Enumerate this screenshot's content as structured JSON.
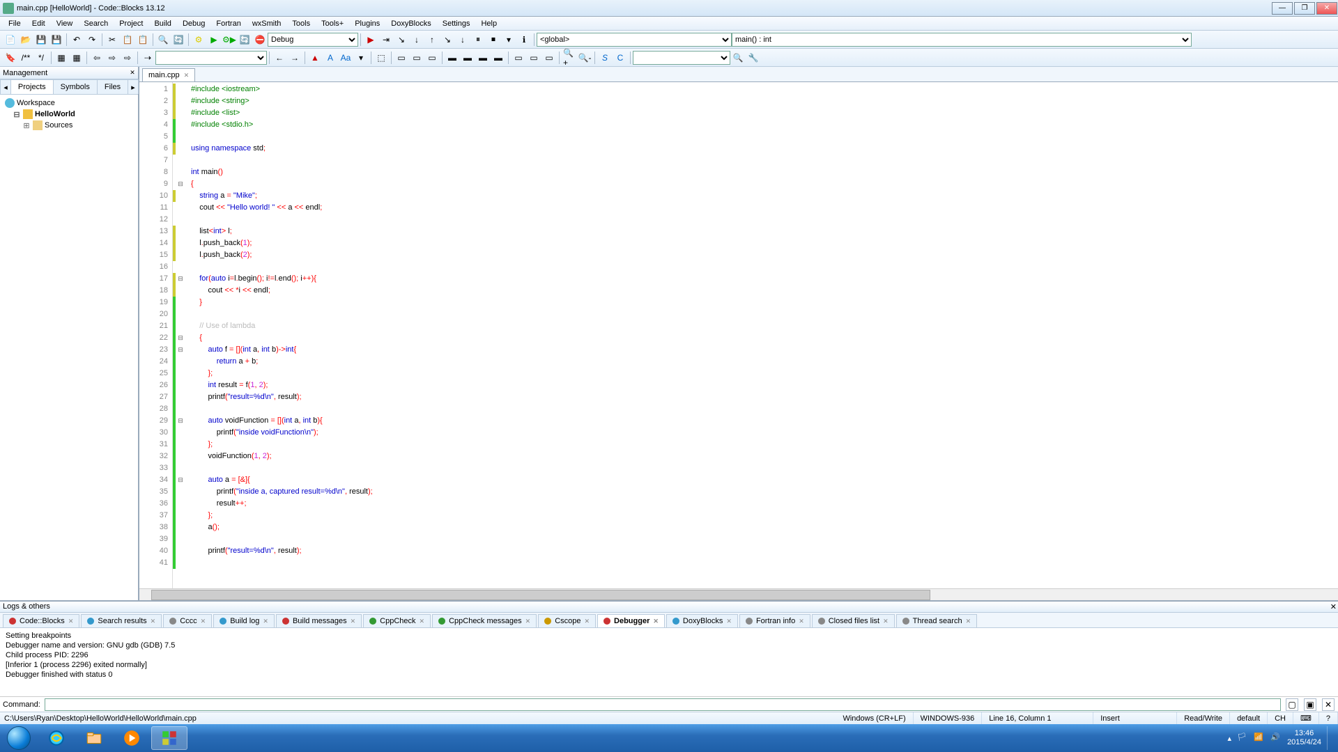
{
  "window": {
    "title": "main.cpp [HelloWorld] - Code::Blocks 13.12"
  },
  "menu": [
    "File",
    "Edit",
    "View",
    "Search",
    "Project",
    "Build",
    "Debug",
    "Fortran",
    "wxSmith",
    "Tools",
    "Tools+",
    "Plugins",
    "DoxyBlocks",
    "Settings",
    "Help"
  ],
  "toolbar1": {
    "build_target": "Debug",
    "scope": "<global>",
    "func": "main() : int"
  },
  "mgmt": {
    "title": "Management",
    "tabs": [
      "Projects",
      "Symbols",
      "Files"
    ],
    "workspace": "Workspace",
    "project": "HelloWorld",
    "folder": "Sources"
  },
  "editor": {
    "tab": "main.cpp",
    "lines": [
      {
        "n": 1,
        "change": "y",
        "tokens": [
          {
            "t": "#include ",
            "c": "pp"
          },
          {
            "t": "<iostream>",
            "c": "pp"
          }
        ]
      },
      {
        "n": 2,
        "change": "y",
        "tokens": [
          {
            "t": "#include ",
            "c": "pp"
          },
          {
            "t": "<string>",
            "c": "pp"
          }
        ]
      },
      {
        "n": 3,
        "change": "y",
        "tokens": [
          {
            "t": "#include ",
            "c": "pp"
          },
          {
            "t": "<list>",
            "c": "pp"
          }
        ]
      },
      {
        "n": 4,
        "change": "g",
        "tokens": [
          {
            "t": "#include ",
            "c": "pp"
          },
          {
            "t": "<stdio.h>",
            "c": "pp"
          }
        ]
      },
      {
        "n": 5,
        "change": "g",
        "tokens": [
          {
            "t": " "
          }
        ]
      },
      {
        "n": 6,
        "change": "y",
        "tokens": [
          {
            "t": "using namespace ",
            "c": "kw"
          },
          {
            "t": "std",
            "c": ""
          },
          {
            "t": ";",
            "c": "op"
          }
        ]
      },
      {
        "n": 7,
        "tokens": [
          {
            "t": " "
          }
        ]
      },
      {
        "n": 8,
        "tokens": [
          {
            "t": "int ",
            "c": "kw"
          },
          {
            "t": "main",
            "c": ""
          },
          {
            "t": "()",
            "c": "op"
          }
        ]
      },
      {
        "n": 9,
        "fold": "[-]",
        "tokens": [
          {
            "t": "{",
            "c": "op"
          }
        ]
      },
      {
        "n": 10,
        "change": "y",
        "tokens": [
          {
            "t": "    "
          },
          {
            "t": "string ",
            "c": "kw"
          },
          {
            "t": "a ",
            "c": ""
          },
          {
            "t": "= ",
            "c": "op"
          },
          {
            "t": "\"Mike\"",
            "c": "str"
          },
          {
            "t": ";",
            "c": "op"
          }
        ]
      },
      {
        "n": 11,
        "tokens": [
          {
            "t": "    "
          },
          {
            "t": "cout ",
            "c": ""
          },
          {
            "t": "<< ",
            "c": "op"
          },
          {
            "t": "\"Hello world! \"",
            "c": "str"
          },
          {
            "t": " << ",
            "c": "op"
          },
          {
            "t": "a",
            "c": ""
          },
          {
            "t": " << ",
            "c": "op"
          },
          {
            "t": "endl",
            "c": ""
          },
          {
            "t": ";",
            "c": "op"
          }
        ]
      },
      {
        "n": 12,
        "tokens": [
          {
            "t": " "
          }
        ]
      },
      {
        "n": 13,
        "change": "y",
        "tokens": [
          {
            "t": "    "
          },
          {
            "t": "list",
            "c": ""
          },
          {
            "t": "<",
            "c": "op"
          },
          {
            "t": "int",
            "c": "kw"
          },
          {
            "t": "> ",
            "c": "op"
          },
          {
            "t": "l",
            "c": ""
          },
          {
            "t": ";",
            "c": "op"
          }
        ]
      },
      {
        "n": 14,
        "change": "y",
        "tokens": [
          {
            "t": "    l"
          },
          {
            "t": ".",
            "c": "op"
          },
          {
            "t": "push_back",
            "c": ""
          },
          {
            "t": "(",
            "c": "op"
          },
          {
            "t": "1",
            "c": "num"
          },
          {
            "t": ");",
            "c": "op"
          }
        ]
      },
      {
        "n": 15,
        "change": "y",
        "tokens": [
          {
            "t": "    l"
          },
          {
            "t": ".",
            "c": "op"
          },
          {
            "t": "push_back",
            "c": ""
          },
          {
            "t": "(",
            "c": "op"
          },
          {
            "t": "2",
            "c": "num"
          },
          {
            "t": ");",
            "c": "op"
          }
        ]
      },
      {
        "n": 16,
        "tokens": [
          {
            "t": " "
          }
        ]
      },
      {
        "n": 17,
        "change": "y",
        "fold": "[-]",
        "tokens": [
          {
            "t": "    "
          },
          {
            "t": "for",
            "c": "kw"
          },
          {
            "t": "(",
            "c": "op"
          },
          {
            "t": "auto ",
            "c": "kw"
          },
          {
            "t": "i",
            "c": ""
          },
          {
            "t": "=",
            "c": "op"
          },
          {
            "t": "l",
            "c": ""
          },
          {
            "t": ".",
            "c": "op"
          },
          {
            "t": "begin",
            "c": ""
          },
          {
            "t": "(); ",
            "c": "op"
          },
          {
            "t": "i",
            "c": ""
          },
          {
            "t": "!=",
            "c": "op"
          },
          {
            "t": "l",
            "c": ""
          },
          {
            "t": ".",
            "c": "op"
          },
          {
            "t": "end",
            "c": ""
          },
          {
            "t": "(); ",
            "c": "op"
          },
          {
            "t": "i",
            "c": ""
          },
          {
            "t": "++){",
            "c": "op"
          }
        ]
      },
      {
        "n": 18,
        "change": "y",
        "tokens": [
          {
            "t": "        "
          },
          {
            "t": "cout ",
            "c": ""
          },
          {
            "t": "<< *",
            "c": "op"
          },
          {
            "t": "i",
            "c": ""
          },
          {
            "t": " << ",
            "c": "op"
          },
          {
            "t": "endl",
            "c": ""
          },
          {
            "t": ";",
            "c": "op"
          }
        ]
      },
      {
        "n": 19,
        "change": "g",
        "tokens": [
          {
            "t": "    "
          },
          {
            "t": "}",
            "c": "op"
          }
        ]
      },
      {
        "n": 20,
        "change": "g",
        "tokens": [
          {
            "t": " "
          }
        ]
      },
      {
        "n": 21,
        "change": "g",
        "tokens": [
          {
            "t": "    "
          },
          {
            "t": "// Use of lambda",
            "c": "cm"
          }
        ]
      },
      {
        "n": 22,
        "change": "g",
        "fold": "[-]",
        "tokens": [
          {
            "t": "    "
          },
          {
            "t": "{",
            "c": "op"
          }
        ]
      },
      {
        "n": 23,
        "change": "g",
        "fold": "[-]",
        "tokens": [
          {
            "t": "        "
          },
          {
            "t": "auto ",
            "c": "kw"
          },
          {
            "t": "f ",
            "c": ""
          },
          {
            "t": "= [](",
            "c": "op"
          },
          {
            "t": "int ",
            "c": "kw"
          },
          {
            "t": "a",
            "c": ""
          },
          {
            "t": ", ",
            "c": "op"
          },
          {
            "t": "int ",
            "c": "kw"
          },
          {
            "t": "b",
            "c": ""
          },
          {
            "t": ")->",
            "c": "op"
          },
          {
            "t": "int",
            "c": "kw"
          },
          {
            "t": "{",
            "c": "op"
          }
        ]
      },
      {
        "n": 24,
        "change": "g",
        "tokens": [
          {
            "t": "            "
          },
          {
            "t": "return ",
            "c": "kw"
          },
          {
            "t": "a ",
            "c": ""
          },
          {
            "t": "+ ",
            "c": "op"
          },
          {
            "t": "b",
            "c": ""
          },
          {
            "t": ";",
            "c": "op"
          }
        ]
      },
      {
        "n": 25,
        "change": "g",
        "tokens": [
          {
            "t": "        "
          },
          {
            "t": "};",
            "c": "op"
          }
        ]
      },
      {
        "n": 26,
        "change": "g",
        "tokens": [
          {
            "t": "        "
          },
          {
            "t": "int ",
            "c": "kw"
          },
          {
            "t": "result ",
            "c": ""
          },
          {
            "t": "= ",
            "c": "op"
          },
          {
            "t": "f",
            "c": ""
          },
          {
            "t": "(",
            "c": "op"
          },
          {
            "t": "1",
            "c": "num"
          },
          {
            "t": ", ",
            "c": "op"
          },
          {
            "t": "2",
            "c": "num"
          },
          {
            "t": ");",
            "c": "op"
          }
        ]
      },
      {
        "n": 27,
        "change": "g",
        "tokens": [
          {
            "t": "        "
          },
          {
            "t": "printf",
            "c": ""
          },
          {
            "t": "(",
            "c": "op"
          },
          {
            "t": "\"result=%d\\n\"",
            "c": "str"
          },
          {
            "t": ", ",
            "c": "op"
          },
          {
            "t": "result",
            "c": ""
          },
          {
            "t": ");",
            "c": "op"
          }
        ]
      },
      {
        "n": 28,
        "change": "g",
        "tokens": [
          {
            "t": " "
          }
        ]
      },
      {
        "n": 29,
        "change": "g",
        "fold": "[-]",
        "tokens": [
          {
            "t": "        "
          },
          {
            "t": "auto ",
            "c": "kw"
          },
          {
            "t": "voidFunction ",
            "c": ""
          },
          {
            "t": "= [](",
            "c": "op"
          },
          {
            "t": "int ",
            "c": "kw"
          },
          {
            "t": "a",
            "c": ""
          },
          {
            "t": ", ",
            "c": "op"
          },
          {
            "t": "int ",
            "c": "kw"
          },
          {
            "t": "b",
            "c": ""
          },
          {
            "t": "){",
            "c": "op"
          }
        ]
      },
      {
        "n": 30,
        "change": "g",
        "tokens": [
          {
            "t": "            "
          },
          {
            "t": "printf",
            "c": ""
          },
          {
            "t": "(",
            "c": "op"
          },
          {
            "t": "\"inside voidFunction\\n\"",
            "c": "str"
          },
          {
            "t": ");",
            "c": "op"
          }
        ]
      },
      {
        "n": 31,
        "change": "g",
        "tokens": [
          {
            "t": "        "
          },
          {
            "t": "};",
            "c": "op"
          }
        ]
      },
      {
        "n": 32,
        "change": "g",
        "tokens": [
          {
            "t": "        "
          },
          {
            "t": "voidFunction",
            "c": ""
          },
          {
            "t": "(",
            "c": "op"
          },
          {
            "t": "1",
            "c": "num"
          },
          {
            "t": ", ",
            "c": "op"
          },
          {
            "t": "2",
            "c": "num"
          },
          {
            "t": ");",
            "c": "op"
          }
        ]
      },
      {
        "n": 33,
        "change": "g",
        "tokens": [
          {
            "t": " "
          }
        ]
      },
      {
        "n": 34,
        "change": "g",
        "fold": "[-]",
        "tokens": [
          {
            "t": "        "
          },
          {
            "t": "auto ",
            "c": "kw"
          },
          {
            "t": "a ",
            "c": ""
          },
          {
            "t": "= [&]{",
            "c": "op"
          }
        ]
      },
      {
        "n": 35,
        "change": "g",
        "tokens": [
          {
            "t": "            "
          },
          {
            "t": "printf",
            "c": ""
          },
          {
            "t": "(",
            "c": "op"
          },
          {
            "t": "\"inside a, captured result=%d\\n\"",
            "c": "str"
          },
          {
            "t": ", ",
            "c": "op"
          },
          {
            "t": "result",
            "c": ""
          },
          {
            "t": ");",
            "c": "op"
          }
        ]
      },
      {
        "n": 36,
        "change": "g",
        "tokens": [
          {
            "t": "            "
          },
          {
            "t": "result",
            "c": ""
          },
          {
            "t": "++;",
            "c": "op"
          }
        ]
      },
      {
        "n": 37,
        "change": "g",
        "tokens": [
          {
            "t": "        "
          },
          {
            "t": "};",
            "c": "op"
          }
        ]
      },
      {
        "n": 38,
        "change": "g",
        "tokens": [
          {
            "t": "        "
          },
          {
            "t": "a",
            "c": ""
          },
          {
            "t": "();",
            "c": "op"
          }
        ]
      },
      {
        "n": 39,
        "change": "g",
        "tokens": [
          {
            "t": " "
          }
        ]
      },
      {
        "n": 40,
        "change": "g",
        "tokens": [
          {
            "t": "        "
          },
          {
            "t": "printf",
            "c": ""
          },
          {
            "t": "(",
            "c": "op"
          },
          {
            "t": "\"result=%d\\n\"",
            "c": "str"
          },
          {
            "t": ", ",
            "c": "op"
          },
          {
            "t": "result",
            "c": ""
          },
          {
            "t": ");",
            "c": "op"
          }
        ]
      },
      {
        "n": 41,
        "change": "g",
        "tokens": [
          {
            "t": " "
          }
        ]
      }
    ]
  },
  "logs": {
    "title": "Logs & others",
    "tabs": [
      "Code::Blocks",
      "Search results",
      "Cccc",
      "Build log",
      "Build messages",
      "CppCheck",
      "CppCheck messages",
      "Cscope",
      "Debugger",
      "DoxyBlocks",
      "Fortran info",
      "Closed files list",
      "Thread search"
    ],
    "active": "Debugger",
    "lines": [
      "Setting breakpoints",
      "Debugger name and version: GNU gdb (GDB) 7.5",
      "Child process PID: 2296",
      "[Inferior 1 (process 2296) exited normally]",
      "Debugger finished with status 0"
    ],
    "cmd_label": "Command:"
  },
  "status": {
    "path": "C:\\Users\\Ryan\\Desktop\\HelloWorld\\HelloWorld\\main.cpp",
    "eol": "Windows (CR+LF)",
    "enc": "WINDOWS-936",
    "pos": "Line 16, Column 1",
    "ins": "Insert",
    "rw": "Read/Write",
    "profile": "default"
  },
  "tray": {
    "time": "13:46",
    "date": "2015/4/24"
  }
}
